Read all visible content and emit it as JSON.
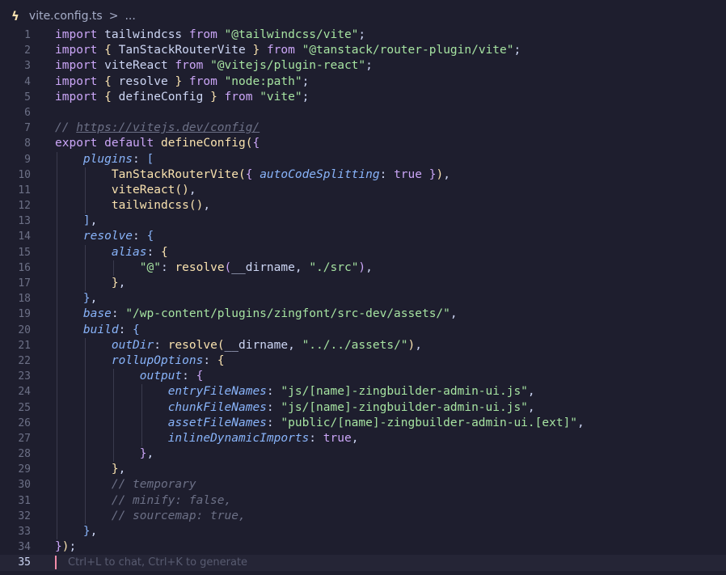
{
  "breadcrumb": {
    "icon": "lightning-icon",
    "file": "vite.config.ts",
    "separator": ">",
    "more": "..."
  },
  "editor": {
    "active_line": 35,
    "hint": "Ctrl+L to chat, Ctrl+K to generate",
    "line_numbers": [
      "1",
      "2",
      "3",
      "4",
      "5",
      "6",
      "7",
      "8",
      "9",
      "10",
      "11",
      "12",
      "13",
      "14",
      "15",
      "16",
      "17",
      "18",
      "19",
      "20",
      "21",
      "22",
      "23",
      "24",
      "25",
      "26",
      "27",
      "28",
      "29",
      "30",
      "31",
      "32",
      "33",
      "34",
      "35"
    ],
    "lines": [
      "import tailwindcss from \"@tailwindcss/vite\";",
      "import { TanStackRouterVite } from \"@tanstack/router-plugin/vite\";",
      "import viteReact from \"@vitejs/plugin-react\";",
      "import { resolve } from \"node:path\";",
      "import { defineConfig } from \"vite\";",
      "",
      "// https://vitejs.dev/config/",
      "export default defineConfig({",
      "    plugins: [",
      "        TanStackRouterVite({ autoCodeSplitting: true }),",
      "        viteReact(),",
      "        tailwindcss(),",
      "    ],",
      "    resolve: {",
      "        alias: {",
      "            \"@\": resolve(__dirname, \"./src\"),",
      "        },",
      "    },",
      "    base: \"/wp-content/plugins/zingfont/src-dev/assets/\",",
      "    build: {",
      "        outDir: resolve(__dirname, \"../../assets/\"),",
      "        rollupOptions: {",
      "            output: {",
      "                entryFileNames: \"js/[name]-zingbuilder-admin-ui.js\",",
      "                chunkFileNames: \"js/[name]-zingbuilder-admin-ui.js\",",
      "                assetFileNames: \"public/[name]-zingbuilder-admin-ui.[ext]\",",
      "                inlineDynamicImports: true,",
      "            },",
      "        },",
      "        // temporary",
      "        // minify: false,",
      "        // sourcemap: true,",
      "    },",
      "});",
      ""
    ]
  },
  "colors": {
    "background": "#1e1e2e",
    "keyword": "#cba6f7",
    "function": "#f9e2af",
    "string": "#a6e3a1",
    "property": "#89b4fa",
    "comment": "#6c7086",
    "boolean": "#fab387",
    "cursor": "#f38ba8"
  }
}
